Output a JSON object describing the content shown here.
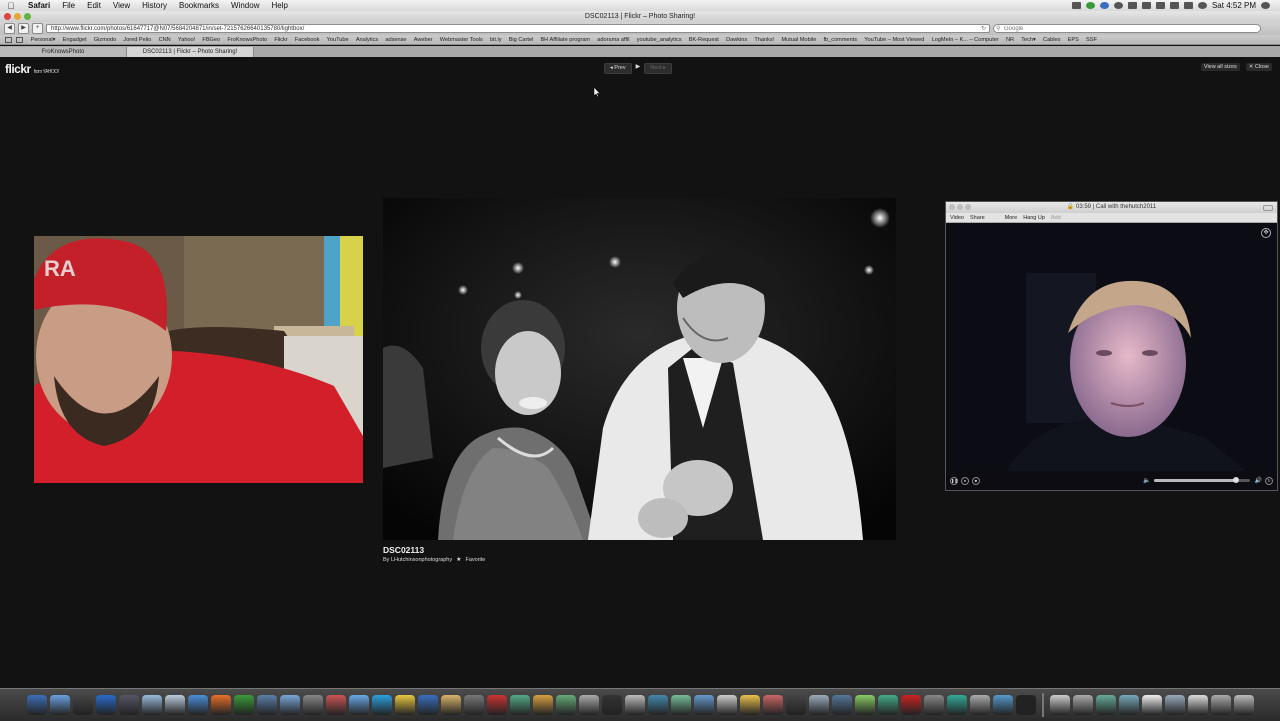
{
  "menubar": {
    "app": "Safari",
    "items": [
      "File",
      "Edit",
      "View",
      "History",
      "Bookmarks",
      "Window",
      "Help"
    ],
    "clock": "Sat 4:52 PM"
  },
  "browser": {
    "window_title": "DSC02113 | Flickr – Photo Sharing!",
    "url": "http://www.flickr.com/photos/61647717@N07/5684204871/in/set-72157626640135780/lightbox/",
    "search_placeholder": "Google",
    "bookmarks": [
      "Personal▾",
      "Engadget",
      "Gizmodo",
      "Jored Pelio",
      "CNN",
      "Yahoo!",
      "FBGeo",
      "FroKnowsPhoto",
      "Flickr",
      "Facebook",
      "YouTube",
      "Analytics",
      "adsense",
      "Aweber",
      "Webmaster Tools",
      "bit.ly",
      "Big Cartel",
      "BH Affiliate program",
      "adorama affil",
      "youtube_analytics",
      "BK-Request",
      "Dawkins",
      "Thanks!",
      "Mutual Mobile",
      "fb_comments",
      "YouTube – Most Viewed",
      "LogMeIn – K... – Computer",
      "NR",
      "Tech▾",
      "Cables",
      "EPS",
      "SSF"
    ],
    "tabs": [
      "FroKnowsPhoto",
      "DSC02113 | Flickr – Photo Sharing!"
    ]
  },
  "flickr": {
    "logo": "flickr",
    "logo_from": "from YAHOO!",
    "prev_label": "◂ Prev",
    "play_label": "▶",
    "next_label": "Next ▸",
    "view_all_sizes": "View all sizes",
    "close_label": "✕ Close",
    "photo_title": "DSC02113",
    "photo_by": "By LHutchinsonphotography",
    "favorite_label": "Favorite"
  },
  "call": {
    "title": "03:59 | Call with thehutch2011",
    "menu": [
      "Video",
      "Share",
      "More",
      "Hang Up",
      "Add"
    ],
    "volume": 0.86
  },
  "colors": {
    "page_bg": "#121212",
    "cap_red": "#c4202a",
    "shirt_red": "#d21f2a"
  }
}
